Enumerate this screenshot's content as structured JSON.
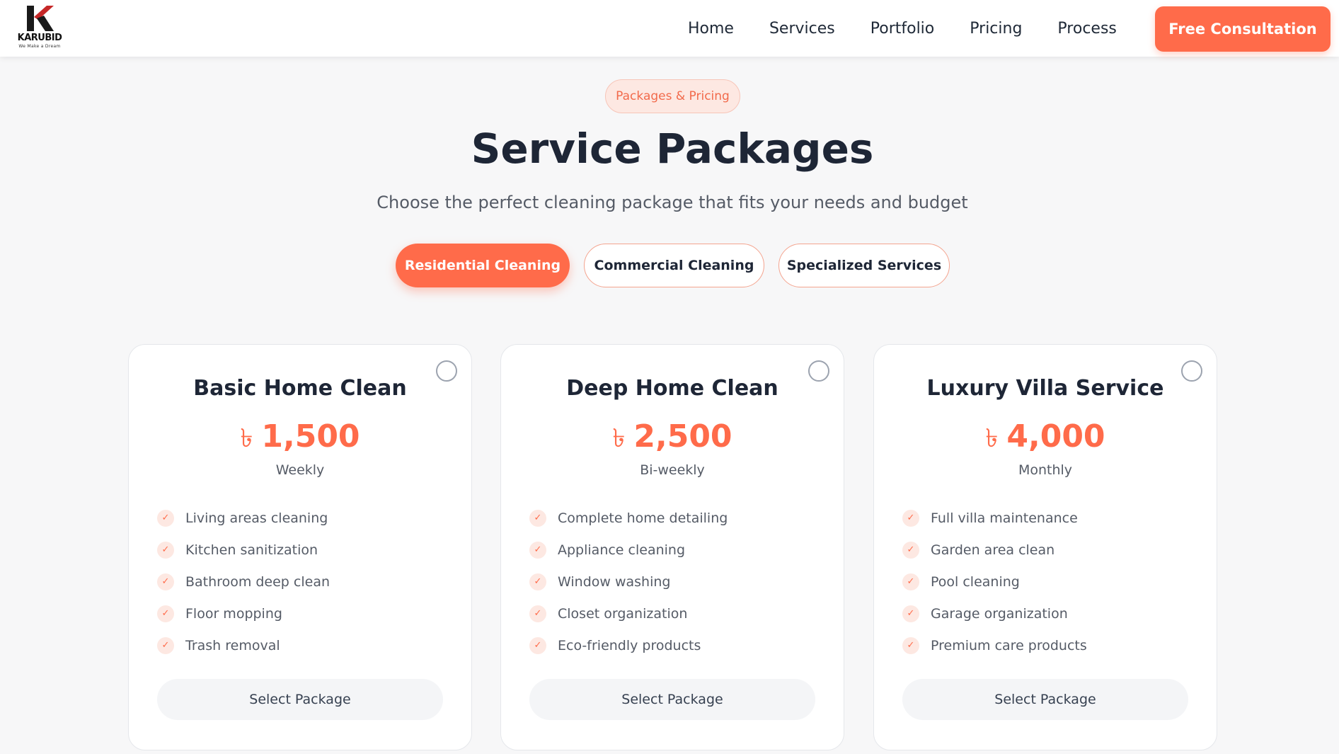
{
  "brand": {
    "name": "KARUBID",
    "tagline": "We Make a Dream"
  },
  "nav": {
    "items": [
      {
        "label": "Home"
      },
      {
        "label": "Services"
      },
      {
        "label": "Portfolio"
      },
      {
        "label": "Pricing"
      },
      {
        "label": "Process"
      }
    ],
    "cta_label": "Free Consultation"
  },
  "section": {
    "badge": "Packages & Pricing",
    "title": "Service Packages",
    "subtitle": "Choose the perfect cleaning package that fits your needs and budget"
  },
  "tabs": [
    {
      "label": "Residential Cleaning",
      "active": true
    },
    {
      "label": "Commercial Cleaning",
      "active": false
    },
    {
      "label": "Specialized Services",
      "active": false
    }
  ],
  "packages": [
    {
      "title": "Basic Home Clean",
      "currency": "৳",
      "price": "1,500",
      "period": "Weekly",
      "features": [
        "Living areas cleaning",
        "Kitchen sanitization",
        "Bathroom deep clean",
        "Floor mopping",
        "Trash removal"
      ],
      "button": "Select Package"
    },
    {
      "title": "Deep Home Clean",
      "currency": "৳",
      "price": "2,500",
      "period": "Bi-weekly",
      "features": [
        "Complete home detailing",
        "Appliance cleaning",
        "Window washing",
        "Closet organization",
        "Eco-friendly products"
      ],
      "button": "Select Package"
    },
    {
      "title": "Luxury Villa Service",
      "currency": "৳",
      "price": "4,000",
      "period": "Monthly",
      "features": [
        "Full villa maintenance",
        "Garden area clean",
        "Pool cleaning",
        "Garage organization",
        "Premium care products"
      ],
      "button": "Select Package"
    }
  ],
  "colors": {
    "accent": "#ff6b4a",
    "heading": "#1e2636",
    "muted": "#555b66"
  },
  "icons": {
    "check": "check-icon",
    "radio": "radio-icon"
  }
}
